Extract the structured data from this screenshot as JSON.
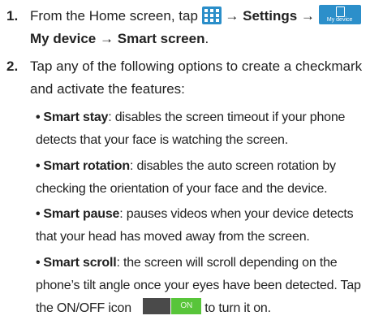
{
  "step1": {
    "number": "1.",
    "text_a": "From the Home screen, tap",
    "arrow1": "→",
    "settings": "Settings",
    "arrow2": "→",
    "mydevice_icon_label": "My device",
    "my_device": "My device",
    "arrow3": "→",
    "smart_screen": "Smart screen",
    "period": ".",
    "apps_icon": "apps-grid-icon",
    "tab_icon": "my-device-icon"
  },
  "step2": {
    "number": "2.",
    "intro": "Tap any of the following options to create a checkmark and activate the features:"
  },
  "bullets": [
    {
      "title": "Smart stay",
      "desc": ": disables the screen timeout if your phone detects that your face is watching the screen."
    },
    {
      "title": "Smart rotation",
      "desc": ": disables the auto screen rotation by checking the orientation of your face and the device."
    },
    {
      "title": "Smart pause",
      "desc": ": pauses videos when your device detects that your head has moved away from the screen."
    },
    {
      "title": "Smart scroll",
      "desc": ": the screen will scroll depending on the phone’s tilt angle once your eyes have been detected. Tap the ON/OFF icon",
      "desc_tail": "to turn it on."
    }
  ],
  "toggle": {
    "on_label": "ON",
    "state": "on",
    "colors": {
      "off": "#4a4a4a",
      "on": "#58c53a"
    }
  },
  "colors": {
    "icon_blue": "#2a8ec9",
    "text": "#222222"
  }
}
